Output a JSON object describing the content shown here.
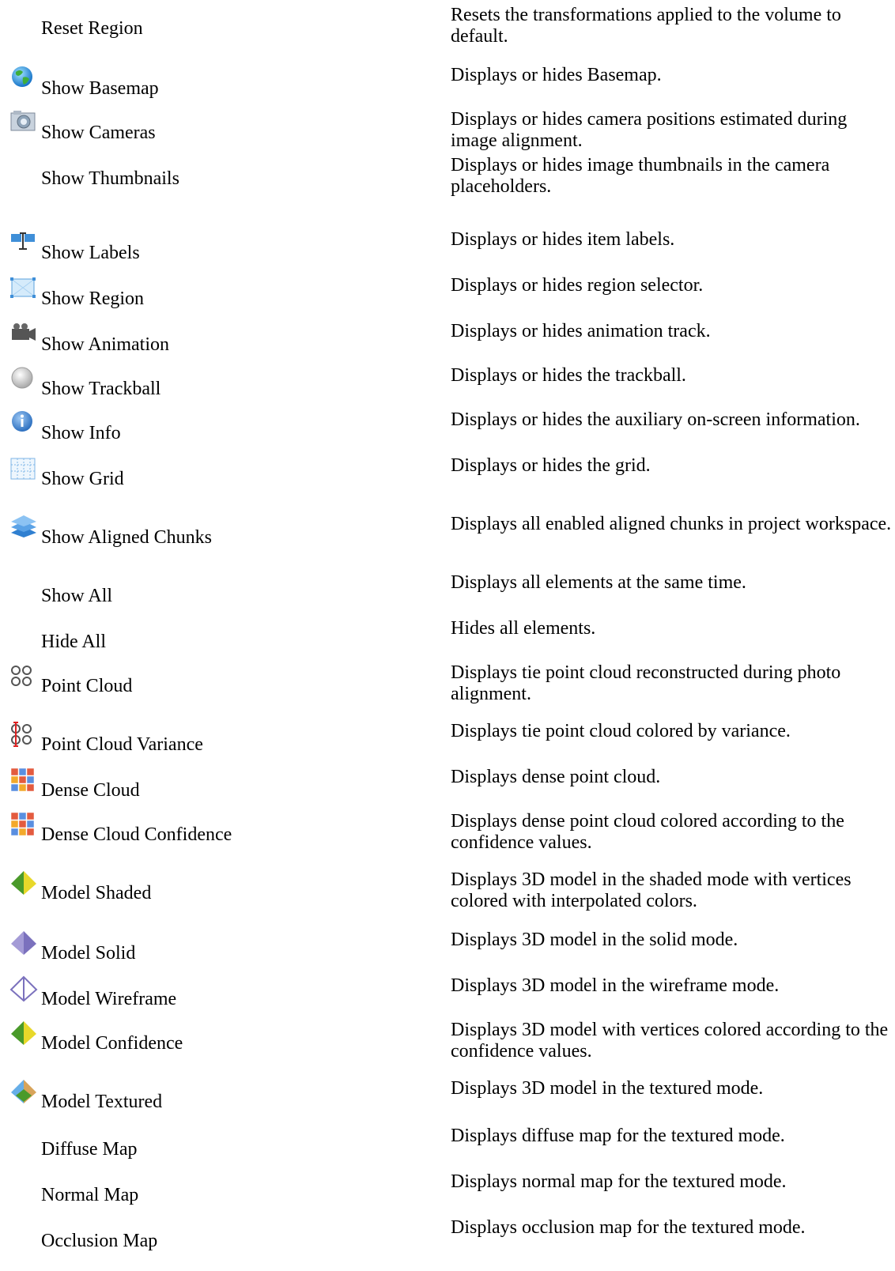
{
  "commands": [
    {
      "label": "Reset Region",
      "icon": "none",
      "description": "Resets the transformations applied to the volume to default."
    },
    {
      "label": "Show Basemap",
      "icon": "globe-icon",
      "description": "Displays or hides Basemap."
    },
    {
      "label": "Show Cameras",
      "icon": "camera-icon",
      "description": "Displays or hides camera positions estimated during image alignment."
    },
    {
      "label": "Show Thumbnails",
      "icon": "none",
      "description": "Displays or hides image thumbnails in the camera placeholders."
    },
    {
      "label": "Show Labels",
      "icon": "label-icon",
      "description": "Displays or hides item labels."
    },
    {
      "label": "Show Region",
      "icon": "region-icon",
      "description": "Displays or hides region selector."
    },
    {
      "label": "Show Animation",
      "icon": "animation-camera-icon",
      "description": "Displays or hides animation track."
    },
    {
      "label": "Show Trackball",
      "icon": "trackball-icon",
      "description": "Displays or hides the trackball."
    },
    {
      "label": "Show Info",
      "icon": "info-icon",
      "description": "Displays or hides the auxiliary on-screen information."
    },
    {
      "label": "Show Grid",
      "icon": "grid-icon",
      "description": "Displays or hides the grid."
    },
    {
      "label": "Show Aligned Chunks",
      "icon": "aligned-chunks-icon",
      "description": "Displays all enabled aligned chunks in project workspace."
    },
    {
      "label": "Show All",
      "icon": "none",
      "description": "Displays all elements at the same time."
    },
    {
      "label": "Hide All",
      "icon": "none",
      "description": "Hides all elements."
    },
    {
      "label": "Point Cloud",
      "icon": "point-cloud-icon",
      "description": "Displays tie point cloud reconstructed during photo alignment."
    },
    {
      "label": "Point Cloud Variance",
      "icon": "point-cloud-variance-icon",
      "description": "Displays tie point cloud colored by variance."
    },
    {
      "label": "Dense Cloud",
      "icon": "dense-cloud-icon",
      "description": "Displays dense point cloud."
    },
    {
      "label": "Dense Cloud Confidence",
      "icon": "dense-cloud-confidence-icon",
      "description": "Displays dense point cloud colored according to the confidence values."
    },
    {
      "label": "Model Shaded",
      "icon": "model-shaded-icon",
      "description": "Displays 3D model in the shaded mode with vertices colored with interpolated colors."
    },
    {
      "label": "Model Solid",
      "icon": "model-solid-icon",
      "description": "Displays 3D model in the solid mode."
    },
    {
      "label": "Model Wireframe",
      "icon": "model-wireframe-icon",
      "description": "Displays 3D model in the wireframe mode."
    },
    {
      "label": "Model Confidence",
      "icon": "model-confidence-icon",
      "description": "Displays 3D model with vertices colored according to the confidence values."
    },
    {
      "label": "Model Textured",
      "icon": "model-textured-icon",
      "description": "Displays 3D model in the textured mode."
    },
    {
      "label": "Diffuse Map",
      "icon": "none",
      "description": "Displays diffuse map for the textured mode."
    },
    {
      "label": "Normal Map",
      "icon": "none",
      "description": "Displays normal map for the textured mode."
    },
    {
      "label": "Occlusion Map",
      "icon": "none",
      "description": "Displays occlusion map for the textured mode."
    }
  ]
}
